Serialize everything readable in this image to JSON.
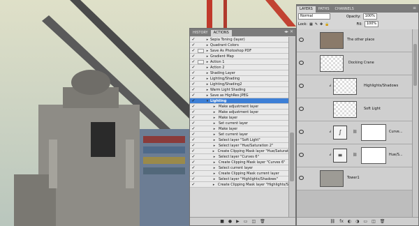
{
  "background_canvas": {
    "description_icon": "photo-canvas"
  },
  "actions_panel": {
    "tabs": [
      {
        "label": "HISTORY"
      },
      {
        "label": "ACTIONS"
      }
    ],
    "active_tab": "ACTIONS",
    "items": [
      {
        "label": "Sepia Toning (layer)",
        "kind": "action",
        "checked": true,
        "dialog": false
      },
      {
        "label": "Quadrant Colors",
        "kind": "action",
        "checked": true,
        "dialog": false
      },
      {
        "label": "Save As Photoshop PDF",
        "kind": "action",
        "checked": true,
        "dialog": true
      },
      {
        "label": "Gradient Map",
        "kind": "action",
        "checked": true,
        "dialog": false
      },
      {
        "label": "Action 1",
        "kind": "action",
        "checked": true,
        "dialog": true
      },
      {
        "label": "Action 2",
        "kind": "action",
        "checked": true,
        "dialog": false
      },
      {
        "label": "Shading Layer",
        "kind": "action",
        "checked": true,
        "dialog": false
      },
      {
        "label": "Lighting/Shading",
        "kind": "action",
        "checked": true,
        "dialog": false
      },
      {
        "label": "Lighting/Shading2",
        "kind": "action",
        "checked": true,
        "dialog": false
      },
      {
        "label": "Warm Light Shading",
        "kind": "action",
        "checked": true,
        "dialog": false
      },
      {
        "label": "Save as HighRes JPEG",
        "kind": "action",
        "checked": true,
        "dialog": false
      },
      {
        "label": "Lighting",
        "kind": "action",
        "checked": true,
        "dialog": false,
        "selected": true,
        "expanded": true
      },
      {
        "label": "Make adjustment layer",
        "kind": "command",
        "checked": true,
        "dialog": false
      },
      {
        "label": "Make adjustment layer",
        "kind": "command",
        "checked": true,
        "dialog": false
      },
      {
        "label": "Make layer",
        "kind": "command",
        "checked": true,
        "dialog": false
      },
      {
        "label": "Set current layer",
        "kind": "command",
        "checked": true,
        "dialog": false
      },
      {
        "label": "Make layer",
        "kind": "command",
        "checked": true,
        "dialog": false
      },
      {
        "label": "Set current layer",
        "kind": "command",
        "checked": true,
        "dialog": false
      },
      {
        "label": "Select layer \"Soft Light\"",
        "kind": "command",
        "checked": true,
        "dialog": false
      },
      {
        "label": "Select layer \"Hue/Saturation 2\"",
        "kind": "command",
        "checked": true,
        "dialog": false
      },
      {
        "label": "Create Clipping Mask layer \"Hue/Saturati...",
        "kind": "command",
        "checked": true,
        "dialog": false
      },
      {
        "label": "Select layer \"Curves 6\"",
        "kind": "command",
        "checked": true,
        "dialog": false
      },
      {
        "label": "Create Clipping Mask layer \"Curves 6\"",
        "kind": "command",
        "checked": true,
        "dialog": false
      },
      {
        "label": "Select current layer",
        "kind": "command",
        "checked": true,
        "dialog": false
      },
      {
        "label": "Create Clipping Mask current layer",
        "kind": "command",
        "checked": true,
        "dialog": false
      },
      {
        "label": "Select layer \"Highlights/Shadows\"",
        "kind": "command",
        "checked": true,
        "dialog": false
      },
      {
        "label": "Create Clipping Mask layer \"Highlights/S...",
        "kind": "command",
        "checked": true,
        "dialog": false
      }
    ],
    "scroll_position": 0.72
  },
  "layers_panel": {
    "tabs": [
      {
        "label": "LAYERS"
      },
      {
        "label": "PATHS"
      },
      {
        "label": "CHANNELS"
      }
    ],
    "blend_mode": "Normal",
    "opacity_label": "Opacity:",
    "opacity_value": "100%",
    "lock_label": "Lock:",
    "fill_label": "Fill:",
    "fill_value": "100%",
    "layers": [
      {
        "name": "The other place",
        "kind": "image"
      },
      {
        "name": "Docking Crane",
        "kind": "image"
      },
      {
        "name": "Highlights/Shadows",
        "kind": "smart",
        "clipped": true
      },
      {
        "name": "Soft Light",
        "kind": "empty",
        "clipped": false
      },
      {
        "name": "Curve...",
        "kind": "adjust-curves",
        "clipped": true
      },
      {
        "name": "Hue/S...",
        "kind": "adjust-hue",
        "clipped": true
      },
      {
        "name": "Tower1",
        "kind": "image"
      }
    ],
    "scroll_position": 0.1
  },
  "colors": {
    "selection": "#3d7fd6",
    "panel_bg": "#d6d6d6",
    "sky_top": "#d9d6b8",
    "sky_bottom": "#b7c4b9"
  }
}
